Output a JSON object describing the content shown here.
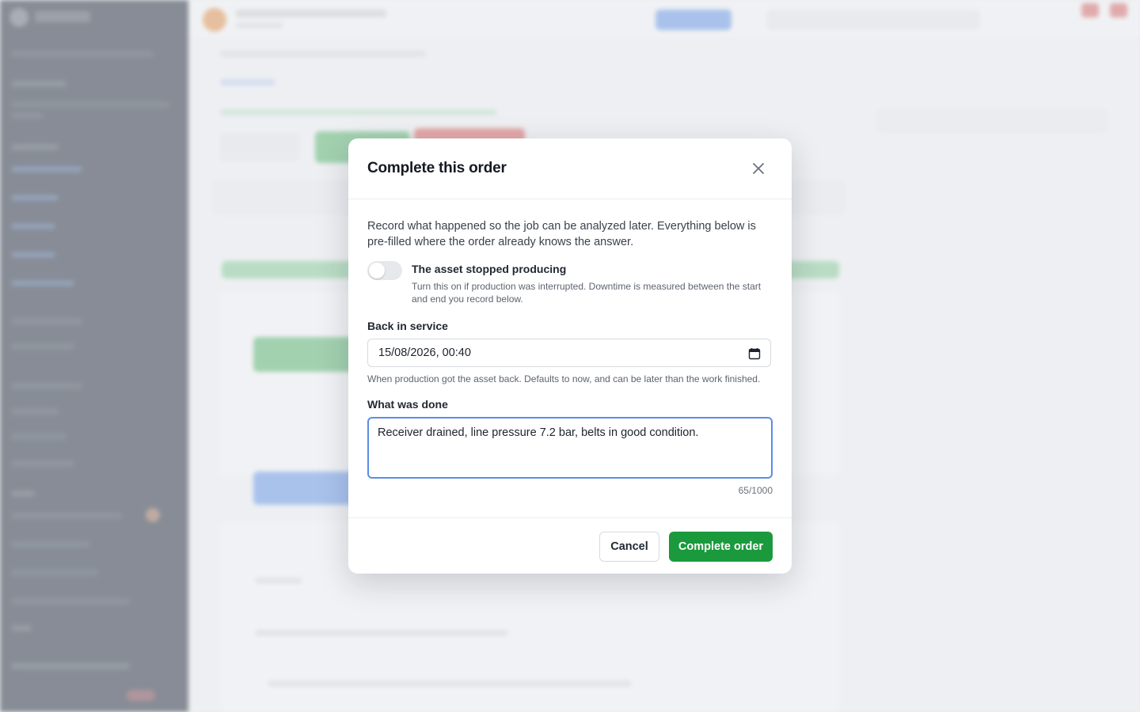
{
  "modal": {
    "title": "Complete this order",
    "intro": "Record what happened so the job can be analyzed later. Everything below is pre-filled where the order already knows the answer.",
    "downtime_toggle": {
      "label": "The asset stopped producing",
      "help": "Turn this on if production was interrupted. Downtime is measured between the start and end you record below.",
      "on": false
    },
    "back_in_service": {
      "label": "Back in service",
      "value": "15/08/2026, 00:40",
      "help": "When production got the asset back. Defaults to now, and can be later than the work finished."
    },
    "what_was_done": {
      "label": "What was done",
      "value": "Receiver drained, line pressure 7.2 bar, belts in good condition.",
      "counter": "65/1000"
    },
    "cancel_label": "Cancel",
    "complete_label": "Complete order"
  },
  "colors": {
    "accent_green": "#1a9a3c",
    "focus_blue": "#5b8de6",
    "sidebar": "#0f1828"
  }
}
